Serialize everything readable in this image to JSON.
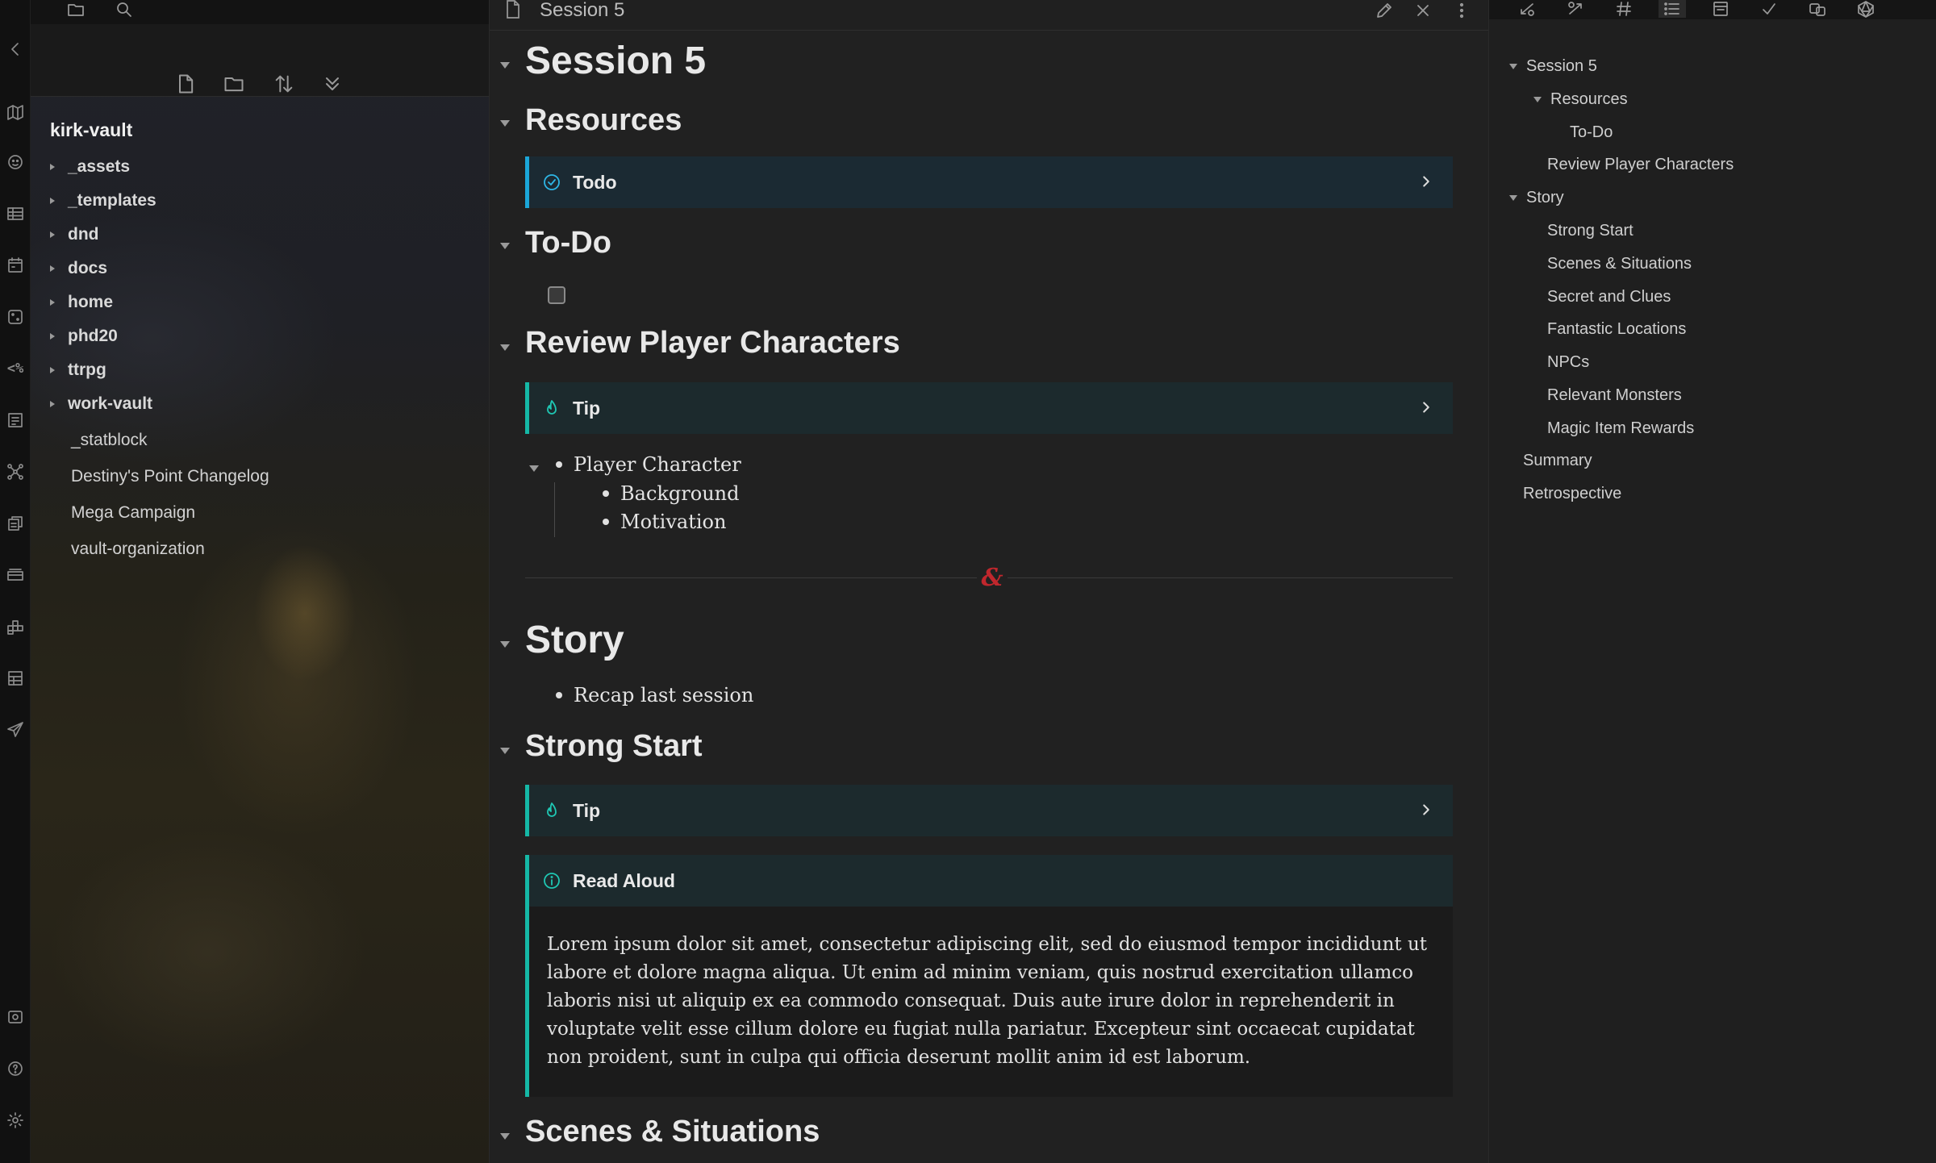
{
  "explorer": {
    "vault_name": "kirk-vault",
    "folders": [
      "_assets",
      "_templates",
      "dnd",
      "docs",
      "home",
      "phd20",
      "ttrpg",
      "work-vault"
    ],
    "files": [
      "_statblock",
      "Destiny's Point Changelog",
      "Mega Campaign",
      "vault-organization"
    ],
    "toolbar": [
      "new-note-icon",
      "new-folder-icon",
      "sort-icon",
      "collapse-all-icon"
    ]
  },
  "ribbon": {
    "icons": [
      "chevron-left-icon",
      "map-icon",
      "face-icon",
      "table-icon",
      "calendar-icon",
      "dice-icon",
      "code-icon",
      "template-icon",
      "graph-icon",
      "copy-icon",
      "cards-icon",
      "blocks-icon",
      "table2-icon",
      "send-icon",
      "vault-icon",
      "help-icon",
      "settings-icon"
    ],
    "code_glyph": "<%"
  },
  "editor": {
    "tab_title": "Session 5",
    "h_session": "Session 5",
    "h_resources": "Resources",
    "callout_todo": "Todo",
    "h_todo": "To-Do",
    "h_review": "Review Player Characters",
    "callout_tip_1": "Tip",
    "list_player_character": "Player Character",
    "list_background": "Background",
    "list_motivation": "Motivation",
    "divider_glyph": "&",
    "h_story": "Story",
    "list_recap": "Recap last session",
    "h_strong_start": "Strong Start",
    "callout_tip_2": "Tip",
    "callout_read_aloud": "Read Aloud",
    "read_aloud_text": "Lorem ipsum dolor sit amet, consectetur adipiscing elit, sed do eiusmod tempor incididunt ut labore et dolore magna aliqua. Ut enim ad minim veniam, quis nostrud exercitation ullamco laboris nisi ut aliquip ex ea commodo consequat. Duis aute irure dolor in reprehenderit in voluptate velit esse cillum dolore eu fugiat nulla pariatur. Excepteur sint occaecat cupidatat non proident, sunt in culpa qui officia deserunt mollit anim id est laborum.",
    "h_scenes": "Scenes & Situations"
  },
  "outline": {
    "items": [
      "Session 5",
      "Resources",
      "To-Do",
      "Review Player Characters",
      "Story",
      "Strong Start",
      "Scenes & Situations",
      "Secret and Clues",
      "Fantastic Locations",
      "NPCs",
      "Relevant Monsters",
      "Magic Item Rewards",
      "Summary",
      "Retrospective"
    ]
  },
  "colors": {
    "accent_teal": "#15b8a6",
    "accent_blue": "#1ba6d8",
    "divider_red": "#c0272d"
  }
}
